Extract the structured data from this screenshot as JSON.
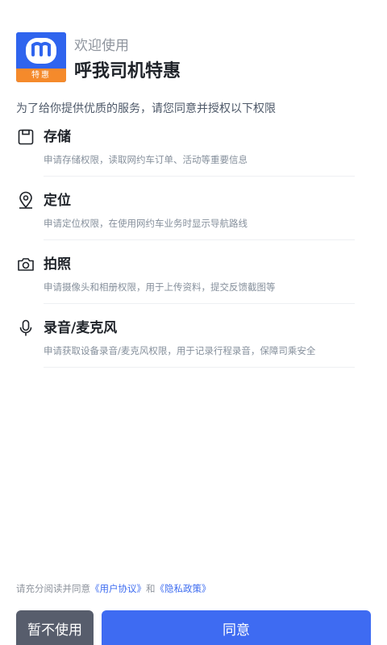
{
  "header": {
    "logo_icon": "app-logo-icon",
    "logo_caption": "特惠",
    "welcome": "欢迎使用",
    "app_name": "呼我司机特惠"
  },
  "intro": "为了给你提供优质的服务，请您同意并授权以下权限",
  "permissions": [
    {
      "icon": "storage-icon",
      "title": "存储",
      "desc": "申请存储权限，读取网约车订单、活动等重要信息"
    },
    {
      "icon": "location-icon",
      "title": "定位",
      "desc": "申请定位权限，在使用网约车业务时显示导航路线"
    },
    {
      "icon": "camera-icon",
      "title": "拍照",
      "desc": "申请摄像头和相册权限，用于上传资料，提交反馈截图等"
    },
    {
      "icon": "microphone-icon",
      "title": "录音/麦克风",
      "desc": "申请获取设备录音/麦克风权限，用于记录行程录音，保障司乘安全"
    }
  ],
  "agreement": {
    "prefix": "请充分阅读并同意",
    "user_agreement": "《用户协议》",
    "and": "和",
    "privacy_policy": "《隐私政策》"
  },
  "buttons": {
    "decline": "暂不使用",
    "agree": "同意"
  },
  "colors": {
    "primary": "#3e6bf2",
    "decline": "#575d6c",
    "logo_blue": "#2f64ee",
    "logo_orange": "#f58a2b",
    "link": "#3d6cf0"
  }
}
